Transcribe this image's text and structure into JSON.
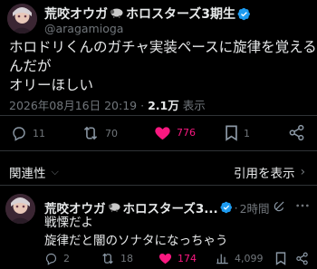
{
  "post": {
    "display_name": "荒咬オウガ",
    "display_name_suffix": "ホロスターズ3期生",
    "handle": "@aragamioga",
    "text_line1": "ホロドリくんのガチャ実装ペースに旋律を覚える",
    "text_line2": "んだが",
    "text_line3": "オリーほしい",
    "timestamp": "2026年08月16日 20:19",
    "views_count": "2.1万",
    "views_label": "表示",
    "replies": "11",
    "reposts": "70",
    "likes": "776",
    "bookmarks": "1"
  },
  "section": {
    "related_label": "関連性",
    "quotes_label": "引用を表示"
  },
  "reply": {
    "display_name": "荒咬オウガ",
    "display_name_suffix": "ホロスターズ3...",
    "time": "2時間",
    "text_line1": "戦慄だよ",
    "text_line2": "旋律だと闇のソナタになっちゃう",
    "replies": "2",
    "reposts": "18",
    "likes": "174",
    "views": "4,099"
  },
  "colors": {
    "verified": "#1d9bf0",
    "like": "#f91880",
    "muted": "#71767b"
  }
}
